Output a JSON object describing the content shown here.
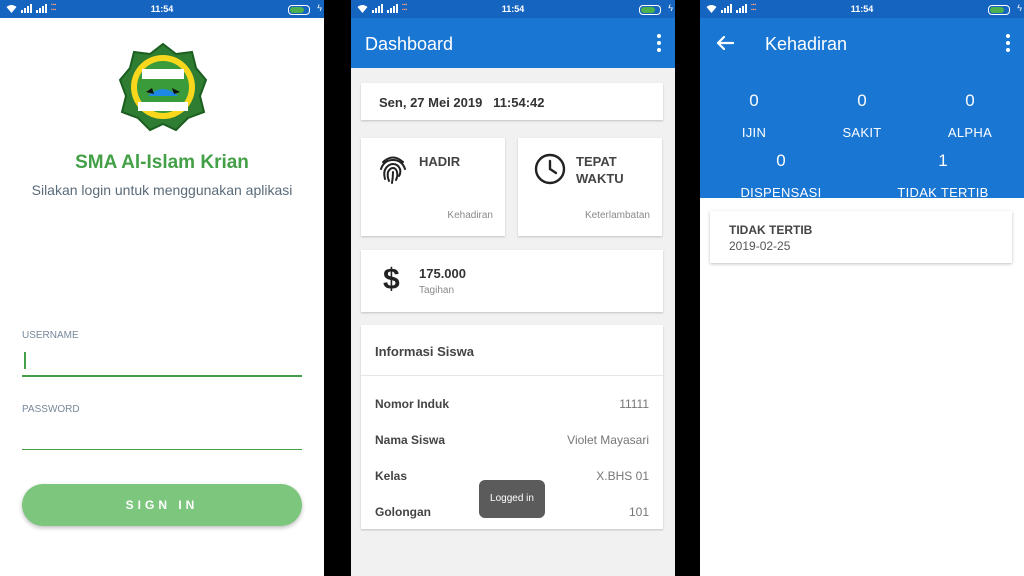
{
  "status": {
    "time": "11:54"
  },
  "login": {
    "school_name": "SMA Al-Islam Krian",
    "subtitle": "Silakan login untuk menggunakan aplikasi",
    "username_label": "USERNAME",
    "password_label": "PASSWORD",
    "signin_label": "SIGN IN",
    "accent_color": "#43a047"
  },
  "dashboard": {
    "title": "Dashboard",
    "datetime": "Sen, 27 Mei 2019   11:54:42",
    "hadir": {
      "value": "HADIR",
      "label": "Kehadiran"
    },
    "tepat": {
      "value_line1": "TEPAT",
      "value_line2": "WAKTU",
      "label": "Keterlambatan"
    },
    "tagihan": {
      "amount": "175.000",
      "label": "Tagihan"
    },
    "info": {
      "heading": "Informasi Siswa",
      "rows": [
        {
          "key": "Nomor Induk",
          "value": "11111"
        },
        {
          "key": "Nama Siswa",
          "value": "Violet Mayasari"
        },
        {
          "key": "Kelas",
          "value": "X.BHS 01"
        },
        {
          "key": "Golongan",
          "value": "101"
        }
      ]
    },
    "toast": "Logged in"
  },
  "kehadiran": {
    "title": "Kehadiran",
    "counts": [
      {
        "num": "0",
        "label": "IJIN"
      },
      {
        "num": "0",
        "label": "SAKIT"
      },
      {
        "num": "0",
        "label": "ALPHA"
      },
      {
        "num": "0",
        "label": "DISPENSASI"
      },
      {
        "num": "1",
        "label": "TIDAK TERTIB"
      }
    ],
    "record": {
      "type": "TIDAK TERTIB",
      "date": "2019-02-25"
    }
  }
}
